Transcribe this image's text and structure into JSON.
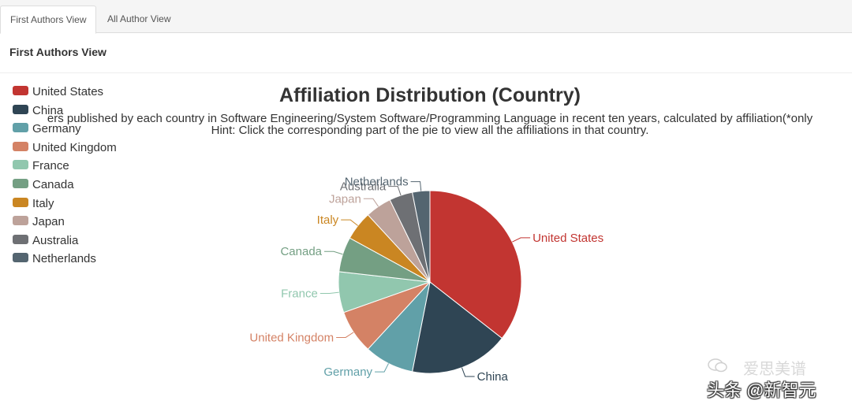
{
  "tabs": [
    {
      "label": "First Authors View",
      "active": true
    },
    {
      "label": "All Author View",
      "active": false
    }
  ],
  "section_title": "First Authors View",
  "chart_data": {
    "type": "pie",
    "title": "Affiliation Distribution (Country)",
    "subtitle_line1": "ers published by each country in Software Engineering/System Software/Programming Language in recent ten years, calculated by affiliation(*only",
    "subtitle_line2": "Hint: Click the corresponding part of the pie to view all the affiliations in that country.",
    "legend_position": "left",
    "categories": [
      "United States",
      "China",
      "Germany",
      "United Kingdom",
      "France",
      "Canada",
      "Italy",
      "Japan",
      "Australia",
      "Netherlands"
    ],
    "values": [
      34.5,
      17.0,
      8.5,
      7.5,
      7.0,
      6.0,
      5.0,
      4.5,
      4.0,
      3.0
    ],
    "colors": [
      "#c23531",
      "#2f4554",
      "#61a0a8",
      "#d48265",
      "#91c7ae",
      "#749f83",
      "#ca8622",
      "#bda29a",
      "#6e7074",
      "#546570"
    ]
  },
  "watermark": "爱思美谱",
  "footer_tag": "头条 @新智元"
}
